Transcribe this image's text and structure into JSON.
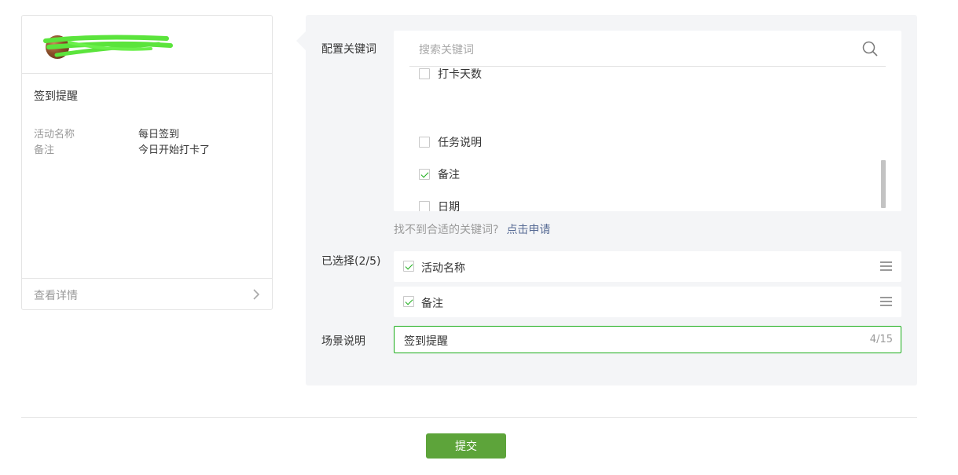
{
  "preview_card": {
    "title": "签到提醒",
    "fields": [
      {
        "key": "活动名称",
        "value": "每日签到"
      },
      {
        "key": "备注",
        "value": "今日开始打卡了"
      }
    ],
    "footer_label": "查看详情",
    "avatar_icon": "avatar",
    "name_redacted": true
  },
  "config": {
    "keywords_label": "配置关键词",
    "search_placeholder": "搜索关键词",
    "keyword_options": [
      {
        "label": "打卡天数",
        "checked": false
      },
      {
        "label": "任务说明",
        "checked": false
      },
      {
        "label": "备注",
        "checked": true
      },
      {
        "label": "日期",
        "checked": false
      }
    ],
    "hint_text": "找不到合适的关键词?",
    "hint_link": "点击申请",
    "selected_label": "已选择(2/5)",
    "selected_items": [
      {
        "label": "活动名称",
        "checked": true
      },
      {
        "label": "备注",
        "checked": true
      }
    ],
    "scene_label": "场景说明",
    "scene_value": "签到提醒",
    "scene_count": "4/15"
  },
  "submit_label": "提交",
  "colors": {
    "accent_green": "#1aad19",
    "button_green": "#5da43a",
    "link_blue": "#576b95",
    "panel_bg": "#f4f5f7"
  }
}
